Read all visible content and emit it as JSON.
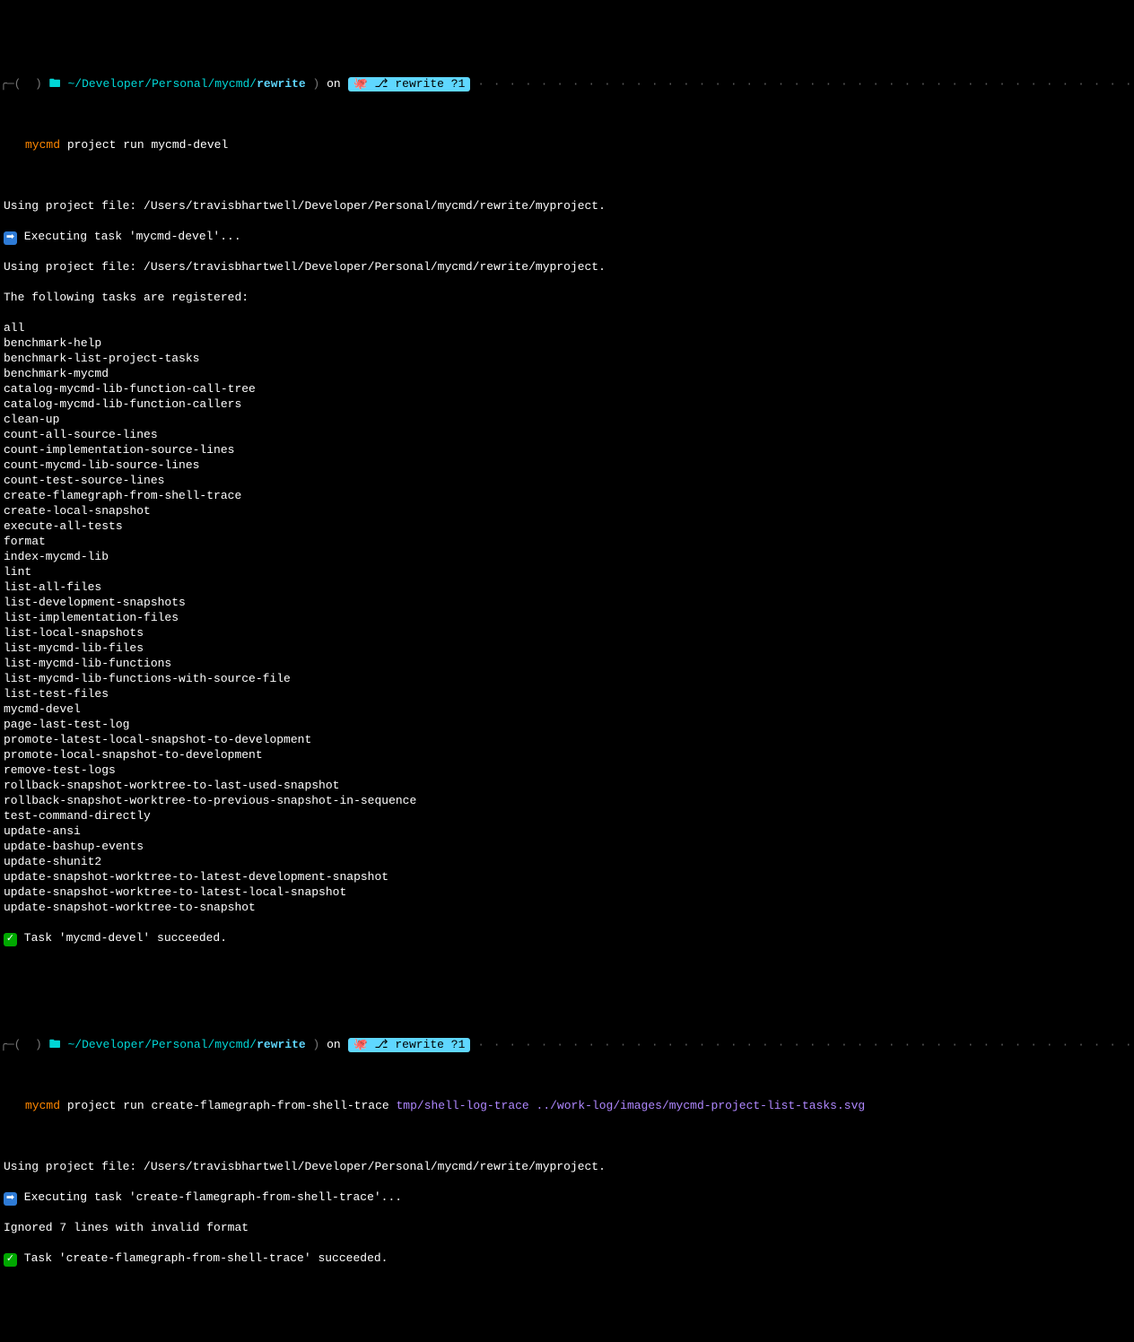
{
  "prompt1": {
    "path_prefix": "~/Developer/Personal/mycmd/",
    "path_branch": "rewrite",
    "on": "on",
    "git_branch": "rewrite",
    "git_status": "?1"
  },
  "cmd1": {
    "program": "mycmd",
    "args": "project run mycmd-devel"
  },
  "out1": {
    "using1": "Using project file: /Users/travisbhartwell/Developer/Personal/mycmd/rewrite/myproject.",
    "exec": " Executing task 'mycmd-devel'...",
    "using2": "Using project file: /Users/travisbhartwell/Developer/Personal/mycmd/rewrite/myproject.",
    "registered": "The following tasks are registered:",
    "tasks": [
      "all",
      "benchmark-help",
      "benchmark-list-project-tasks",
      "benchmark-mycmd",
      "catalog-mycmd-lib-function-call-tree",
      "catalog-mycmd-lib-function-callers",
      "clean-up",
      "count-all-source-lines",
      "count-implementation-source-lines",
      "count-mycmd-lib-source-lines",
      "count-test-source-lines",
      "create-flamegraph-from-shell-trace",
      "create-local-snapshot",
      "execute-all-tests",
      "format",
      "index-mycmd-lib",
      "lint",
      "list-all-files",
      "list-development-snapshots",
      "list-implementation-files",
      "list-local-snapshots",
      "list-mycmd-lib-files",
      "list-mycmd-lib-functions",
      "list-mycmd-lib-functions-with-source-file",
      "list-test-files",
      "mycmd-devel",
      "page-last-test-log",
      "promote-latest-local-snapshot-to-development",
      "promote-local-snapshot-to-development",
      "remove-test-logs",
      "rollback-snapshot-worktree-to-last-used-snapshot",
      "rollback-snapshot-worktree-to-previous-snapshot-in-sequence",
      "test-command-directly",
      "update-ansi",
      "update-bashup-events",
      "update-shunit2",
      "update-snapshot-worktree-to-latest-development-snapshot",
      "update-snapshot-worktree-to-latest-local-snapshot",
      "update-snapshot-worktree-to-snapshot"
    ],
    "success": " Task 'mycmd-devel' succeeded."
  },
  "prompt2": {
    "path_prefix": "~/Developer/Personal/mycmd/",
    "path_branch": "rewrite",
    "on": "on",
    "git_branch": "rewrite",
    "git_status": "?1"
  },
  "cmd2": {
    "program": "mycmd",
    "args_white": "project run create-flamegraph-from-shell-trace ",
    "args_purple": "tmp/shell-log-trace ../work-log/images/mycmd-project-list-tasks.svg"
  },
  "out2": {
    "using": "Using project file: /Users/travisbhartwell/Developer/Personal/mycmd/rewrite/myproject.",
    "exec": " Executing task 'create-flamegraph-from-shell-trace'...",
    "ignored": "Ignored 7 lines with invalid format",
    "success": " Task 'create-flamegraph-from-shell-trace' succeeded."
  },
  "dots_fill": "· · · · · · · · · · · · · · · · · · · · · · · · · · · · · · · · · · · · · · · · · · · · · · · · · · · · · · · · · · · · · · · · · · · · · · · · · · · · · · · · · · · · · · · · · · · · · · · · · · · · · · · · · · · · · · · · · · · · · · · · · · · · · · · · · · · · · · · · · · · · · · · · · · · · · · · · · · ·"
}
